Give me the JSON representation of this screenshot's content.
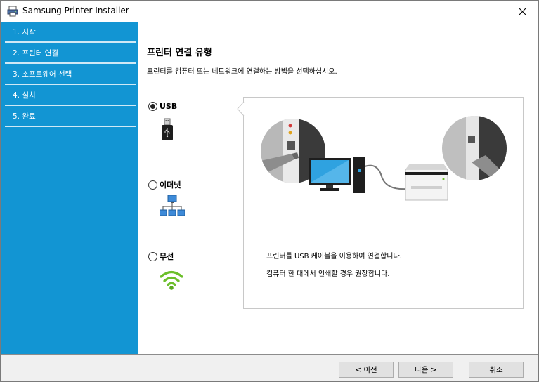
{
  "window": {
    "title": "Samsung Printer Installer",
    "icon": "printer-installer-icon"
  },
  "sidebar": {
    "steps": [
      {
        "label": "1. 시작"
      },
      {
        "label": "2. 프린터 연결"
      },
      {
        "label": "3. 소프트웨어 선택"
      },
      {
        "label": "4. 설치"
      },
      {
        "label": "5. 완료"
      }
    ]
  },
  "main": {
    "title": "프린터 연결 유형",
    "description": "프린터를 컴퓨터 또는 네트워크에 연결하는 방법을 선택하십시오.",
    "options": [
      {
        "label": "USB",
        "selected": true,
        "icon": "usb-icon"
      },
      {
        "label": "이더넷",
        "selected": false,
        "icon": "ethernet-network-icon"
      },
      {
        "label": "무선",
        "selected": false,
        "icon": "wireless-icon"
      }
    ],
    "panel": {
      "line1": "프린터를 USB 케이블을 이용하여 연결합니다.",
      "line2": "컴퓨터 한 대에서 인쇄할 경우 권장합니다."
    }
  },
  "footer": {
    "back_label": "< 이전",
    "next_label": "다음 >",
    "cancel_label": "취소"
  },
  "colors": {
    "sidebar": "#1295d3",
    "sidebar_divider": "#cfe9f6",
    "wifi": "#6cbf2b"
  }
}
